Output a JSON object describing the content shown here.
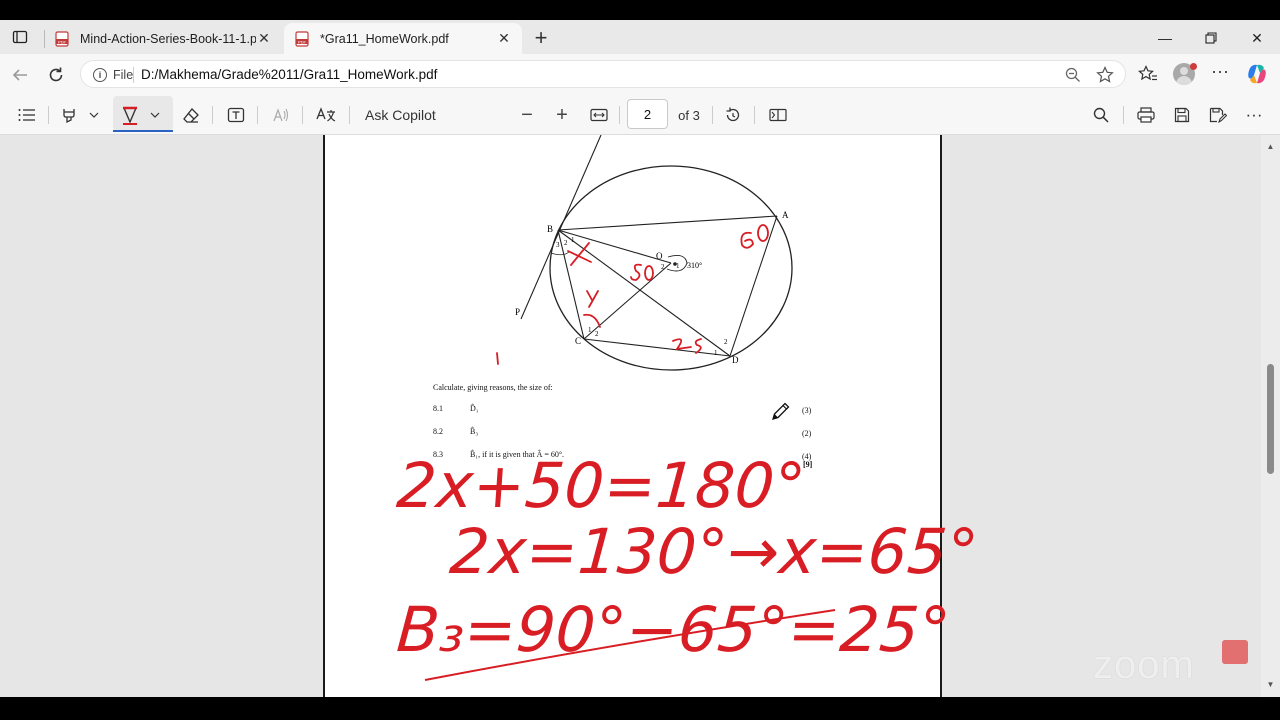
{
  "browser": {
    "tabs": [
      {
        "title": "Mind-Action-Series-Book-11-1.pdf",
        "active": false
      },
      {
        "title": "*Gra11_HomeWork.pdf",
        "active": true
      }
    ],
    "address": {
      "chip": "File",
      "url": "D:/Makhema/Grade%2011/Gra11_HomeWork.pdf"
    }
  },
  "pdf_toolbar": {
    "ask_copilot": "Ask Copilot",
    "page_current": "2",
    "page_total": "of 3",
    "zoom_out": "−",
    "zoom_in": "+"
  },
  "document": {
    "diagram_labels": {
      "A": "A",
      "B": "B",
      "C": "C",
      "D": "D",
      "O": "O",
      "P": "P",
      "angle_310": "310°",
      "b3": "3",
      "b2": "2",
      "b1": "1",
      "c1": "1",
      "c2": "2",
      "d1": "1",
      "d2": "2",
      "o1": "1",
      "o2": "2"
    },
    "instruction": "Calculate, giving reasons, the size of:",
    "questions": [
      {
        "num": "8.1",
        "text": "D̂₁",
        "marks": "(3)"
      },
      {
        "num": "8.2",
        "text": "B̂₃",
        "marks": "(2)"
      },
      {
        "num": "8.3",
        "text": "B̂₁, if it is given that  Â = 60°.",
        "marks": "(4)"
      }
    ],
    "total_marks": "[9]"
  },
  "handwriting": {
    "line1": "2x+50=180°",
    "line2": "2x=130°→x=65°",
    "line3": "B₃=90°−65°=25°",
    "annot_a": "60°",
    "annot_o": "50°",
    "annot_d": "25°",
    "annot_b": "x",
    "annot_c": "x"
  },
  "watermark": "zoom",
  "colors": {
    "ink": "#d81e24",
    "accent": "#2b63c4"
  }
}
